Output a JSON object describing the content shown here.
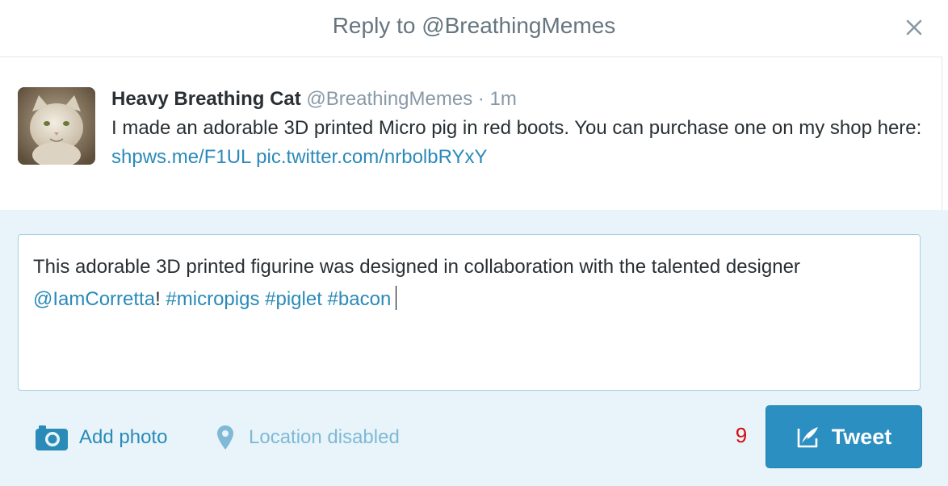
{
  "dialog": {
    "title": "Reply to @BreathingMemes",
    "close_icon": "close-icon"
  },
  "original_tweet": {
    "author_name": "Heavy Breathing Cat",
    "author_handle": "@BreathingMemes",
    "separator": "·",
    "time": "1m",
    "text_before_links": "I made an adorable 3D printed Micro pig in red boots. You can purchase one on my shop here: ",
    "link_1": "shpws.me/F1UL",
    "link_2": "pic.twitter.com/nrbolbRYxY",
    "avatar_icon": "cat-avatar"
  },
  "compose": {
    "text_part_1": "This adorable 3D printed figurine was designed in collaboration with the talented designer ",
    "mention": "@IamCorretta",
    "text_part_2": "! ",
    "hashtag_1": "#micropigs",
    "hashtag_2": "#piglet",
    "hashtag_3": "#bacon",
    "add_photo_label": "Add photo",
    "add_photo_icon": "camera-icon",
    "location_label": "Location disabled",
    "location_icon": "location-pin-icon",
    "char_counter": "9",
    "tweet_button_label": "Tweet",
    "tweet_button_icon": "compose-quill-icon"
  },
  "colors": {
    "accent": "#2b8fc2",
    "link": "#2a8ab8",
    "counter_warning": "#d40d12",
    "compose_background": "#e8f4f9"
  }
}
